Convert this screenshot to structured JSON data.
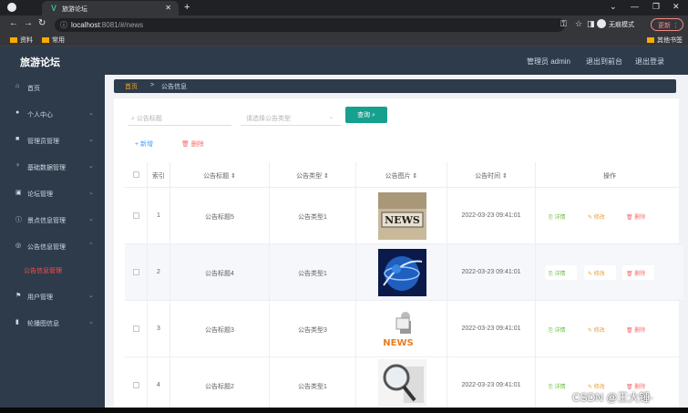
{
  "browser": {
    "tab_title": "旅游论坛",
    "address_host": "localhost",
    "address_rest": ":8081/#/news",
    "incognito_label": "无痕模式",
    "update_label": "更新",
    "bookmarks": [
      "资料",
      "常用"
    ],
    "other_bookmarks": "其他书签"
  },
  "header": {
    "app_title": "旅游论坛",
    "admin_label": "管理员 admin",
    "backend_label": "退出到前台",
    "logout_label": "退出登录"
  },
  "sidebar": {
    "items": [
      {
        "icon": "home-icon",
        "label": "首页"
      },
      {
        "icon": "user-icon",
        "label": "个人中心"
      },
      {
        "icon": "admin-icon",
        "label": "管理员管理"
      },
      {
        "icon": "data-icon",
        "label": "基础数据管理"
      },
      {
        "icon": "forum-icon",
        "label": "论坛管理"
      },
      {
        "icon": "info-icon",
        "label": "景点信息管理"
      },
      {
        "icon": "announce-icon",
        "label": "公告信息管理"
      },
      {
        "icon": "sub",
        "label": "公告信息管理"
      },
      {
        "icon": "flag-icon",
        "label": "用户管理"
      },
      {
        "icon": "chart-icon",
        "label": "轮播图信息"
      }
    ]
  },
  "breadcrumb": {
    "home": "首页",
    "separator": ">",
    "current": "公告信息"
  },
  "search": {
    "title_placeholder": "公告标题",
    "type_placeholder": "请选择公告类型",
    "query_label": "查询"
  },
  "actions": {
    "add_label": "新增",
    "delete_label": "删除"
  },
  "table": {
    "headers": [
      "索引",
      "公告标题",
      "公告类型",
      "公告图片",
      "公告时间",
      "操作"
    ],
    "rows": [
      {
        "index": "1",
        "title": "公告标题5",
        "type": "公告类型1",
        "time": "2022-03-23 09:41:01"
      },
      {
        "index": "2",
        "title": "公告标题4",
        "type": "公告类型1",
        "time": "2022-03-23 09:41:01"
      },
      {
        "index": "3",
        "title": "公告标题3",
        "type": "公告类型3",
        "time": "2022-03-23 09:41:01"
      },
      {
        "index": "4",
        "title": "公告标题2",
        "type": "公告类型1",
        "time": "2022-03-23 09:41:01"
      }
    ],
    "row_actions": {
      "detail": "详情",
      "edit": "修改",
      "remove": "删除"
    }
  },
  "thumbnail_text": "NEWS",
  "watermark": "CSDN @王大锤·"
}
